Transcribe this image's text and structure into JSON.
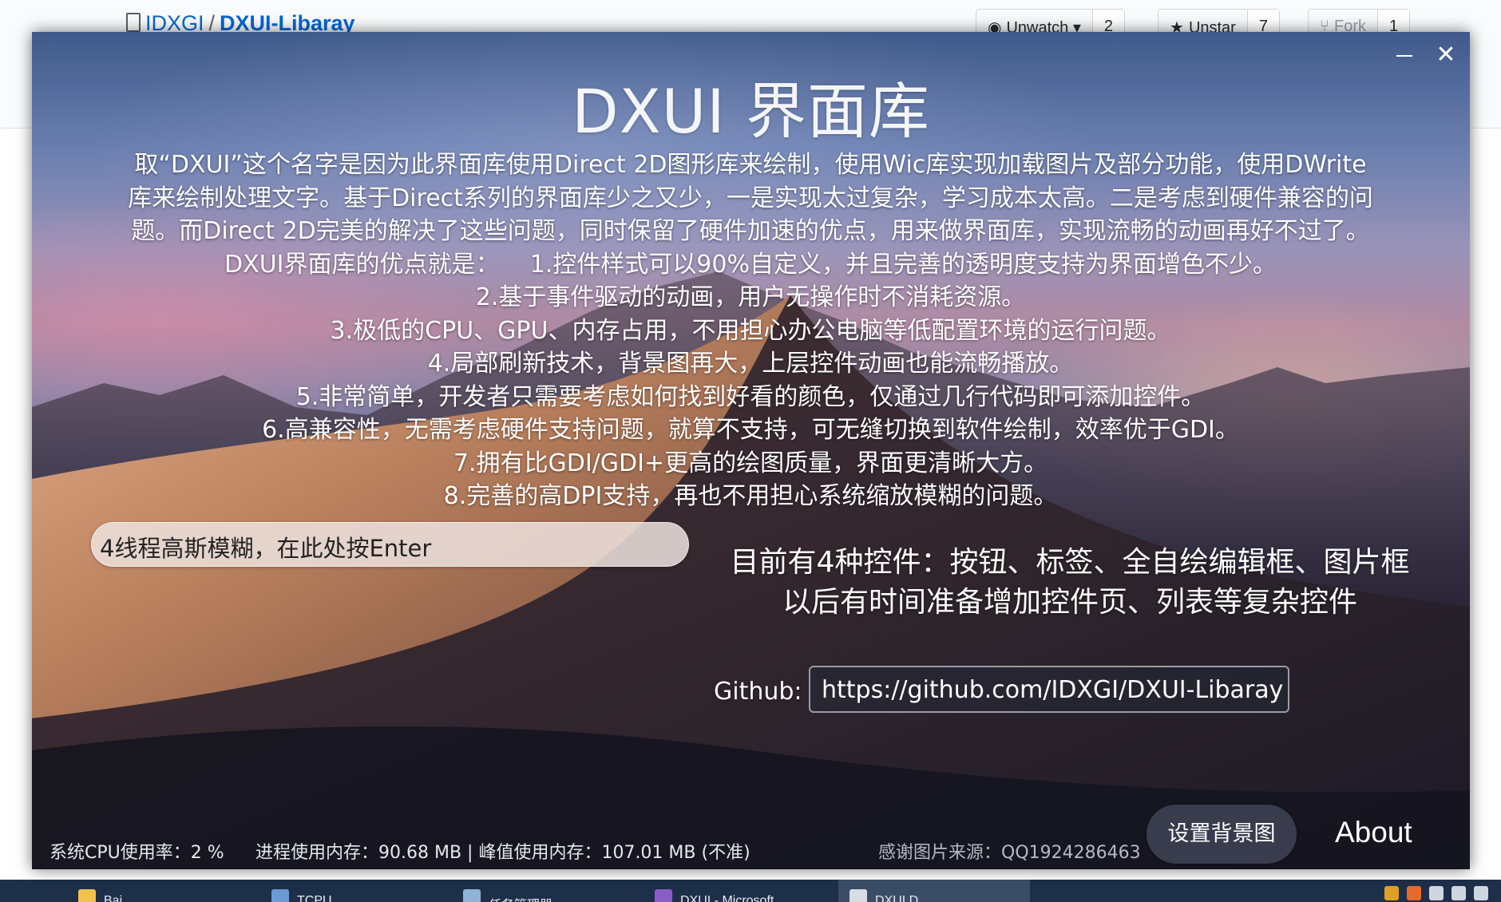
{
  "browser": {
    "repo_owner": "IDXGI",
    "repo_sep": "/",
    "repo_name": "DXUI-Libaray",
    "watch_label": "Unwatch ▾",
    "watch_count": "2",
    "star_label": "Unstar",
    "star_count": "7",
    "fork_label": "Fork",
    "fork_count": "1"
  },
  "window": {
    "title": "DXUI 界面库",
    "close_glyph": "✕",
    "description": [
      "取“DXUI”这个名字是因为此界面库使用Direct 2D图形库来绘制，使用Wic库实现加载图片及部分功能，使用DWrite",
      "库来绘制处理文字。基于Direct系列的界面库少之又少，一是实现太过复杂，学习成本太高。二是考虑到硬件兼容的问",
      "题。而Direct 2D完美的解决了这些问题，同时保留了硬件加速的优点，用来做界面库，实现流畅的动画再好不过了。",
      "DXUI界面库的优点就是：    1.控件样式可以90%自定义，并且完善的透明度支持为界面增色不少。",
      "2.基于事件驱动的动画，用户无操作时不消耗资源。",
      "3.极低的CPU、GPU、内存占用，不用担心办公电脑等低配置环境的运行问题。",
      "4.局部刷新技术，背景图再大，上层控件动画也能流畅播放。",
      "5.非常简单，开发者只需要考虑如何找到好看的颜色，仅通过几行代码即可添加控件。",
      "6.高兼容性，无需考虑硬件支持问题，就算不支持，可无缝切换到软件绘制，效率优于GDI。",
      "7.拥有比GDI/GDI+更高的绘图质量，界面更清晰大方。",
      "8.完善的高DPI支持，再也不用担心系统缩放模糊的问题。"
    ],
    "blur_input_value": "4线程高斯模糊，在此处按Enter",
    "controls_info": [
      "目前有4种控件：按钮、标签、全自绘编辑框、图片框",
      "以后有时间准备增加控件页、列表等复杂控件"
    ],
    "github_label": "Github:",
    "github_url": "https://github.com/IDXGI/DXUI-Libaray",
    "cpu_status": "系统CPU使用率：2 %",
    "mem_status": "进程使用内存：90.68 MB | 峰值使用内存：107.01 MB (不准)",
    "credit": "感谢图片来源：QQ1924286463",
    "set_background_label": "设置背景图",
    "about_label": "About"
  },
  "taskbar": {
    "items": [
      "Bai...",
      "TCPU...",
      "任务管理器",
      "DXUI - Microsoft...",
      "DXUI D..."
    ]
  }
}
